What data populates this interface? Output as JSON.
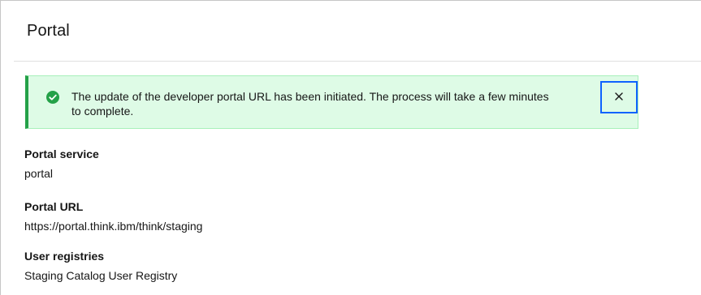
{
  "page": {
    "title": "Portal"
  },
  "notification": {
    "kind": "success",
    "message": "The update of the developer portal URL has been initiated. The process will take a few minutes to complete.",
    "icon": "checkmark-filled-icon",
    "close_icon": "close-icon",
    "colors": {
      "background": "#defbe6",
      "accent": "#24a148",
      "focus": "#0f62fe"
    }
  },
  "details": {
    "portal_service": {
      "label": "Portal service",
      "value": "portal"
    },
    "portal_url": {
      "label": "Portal URL",
      "value": "https://portal.think.ibm/think/staging"
    },
    "user_registries": {
      "label": "User registries",
      "value": "Staging Catalog User Registry"
    }
  }
}
